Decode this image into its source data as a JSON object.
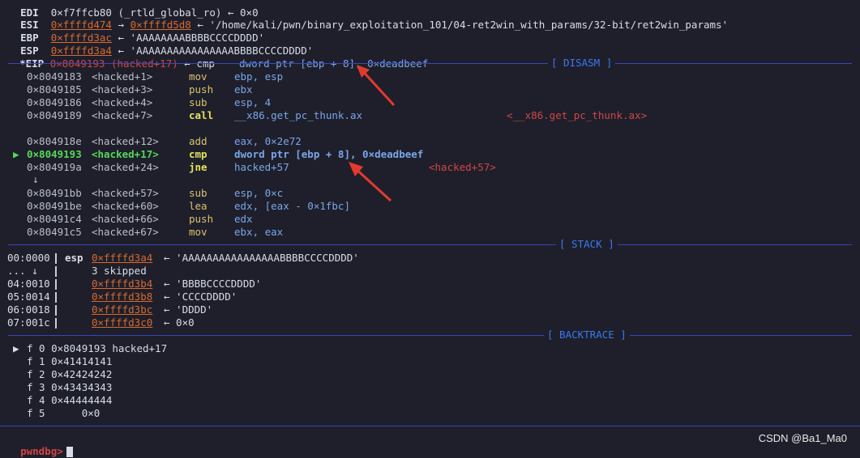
{
  "registers": [
    {
      "name": "EDI",
      "addr": "0×f7ffcb80",
      "rest": "(_rtld_global_ro) ← 0×0",
      "partial": true
    },
    {
      "name": "ESI",
      "addr": "0×ffffd474",
      "arrow": "→",
      "addr2": "0×ffffd5d8",
      "rest": "← '/home/kali/pwn/binary_exploitation_101/04-ret2win_with_params/32-bit/ret2win_params'"
    },
    {
      "name": "EBP",
      "addr": "0×ffffd3ac",
      "rest": "← 'AAAAAAAABBBBCCCCDDDD'"
    },
    {
      "name": "ESP",
      "addr": "0×ffffd3a4",
      "rest": "← 'AAAAAAAAAAAAAAAABBBBCCCCDDDD'"
    },
    {
      "name": "*EIP",
      "addr": "0×8049193 (hacked+17)",
      "arrow": "← cmp",
      "operand": "dword ptr [ebp + 8], 0×deadbeef"
    }
  ],
  "sections": {
    "disasm": "[ DISASM ]",
    "stack": "[ STACK ]",
    "backtrace": "[ BACKTRACE ]"
  },
  "disasm": [
    {
      "addr": "0×8049183",
      "sym": "<hacked+1>",
      "mn": "mov",
      "op": "ebp, esp",
      "extra": ""
    },
    {
      "addr": "0×8049185",
      "sym": "<hacked+3>",
      "mn": "push",
      "op": "ebx",
      "extra": ""
    },
    {
      "addr": "0×8049186",
      "sym": "<hacked+4>",
      "mn": "sub",
      "op": "esp, 4",
      "extra": ""
    },
    {
      "addr": "0×8049189",
      "sym": "<hacked+7>",
      "mn": "call",
      "op": "__x86.get_pc_thunk.ax",
      "extra": "<__x86.get_pc_thunk.ax>"
    },
    {
      "addr": "0×804918e",
      "sym": "<hacked+12>",
      "mn": "add",
      "op": "eax, 0×2e72",
      "extra": ""
    },
    {
      "addr": "0×8049193",
      "sym": "<hacked+17>",
      "mn": "cmp",
      "op": "dword ptr [ebp + 8], 0×deadbeef",
      "extra": "",
      "current": true
    },
    {
      "addr": "0×804919a",
      "sym": "<hacked+24>",
      "mn": "jne",
      "op": "hacked+57",
      "extra": "<hacked+57>"
    },
    {
      "addr": "0×80491bb",
      "sym": "<hacked+57>",
      "mn": "sub",
      "op": "esp, 0×c",
      "extra": ""
    },
    {
      "addr": "0×80491be",
      "sym": "<hacked+60>",
      "mn": "lea",
      "op": "edx, [eax - 0×1fbc]",
      "extra": ""
    },
    {
      "addr": "0×80491c4",
      "sym": "<hacked+66>",
      "mn": "push",
      "op": "edx",
      "extra": ""
    },
    {
      "addr": "0×80491c5",
      "sym": "<hacked+67>",
      "mn": "mov",
      "op": "ebx, eax",
      "extra": ""
    }
  ],
  "disasm_marker": "▶",
  "down_arrow": "↓",
  "stack": [
    {
      "idx": "00:0000",
      "reg": "esp",
      "addr": "0×ffffd3a4",
      "val": "← 'AAAAAAAAAAAAAAAABBBBCCCCDDDD'"
    },
    {
      "idx": "... ↓",
      "reg": "",
      "addr": "",
      "val": "3 skipped"
    },
    {
      "idx": "04:0010",
      "reg": "",
      "addr": "0×ffffd3b4",
      "val": "← 'BBBBCCCCDDDD'"
    },
    {
      "idx": "05:0014",
      "reg": "",
      "addr": "0×ffffd3b8",
      "val": "← 'CCCCDDDD'"
    },
    {
      "idx": "06:0018",
      "reg": "",
      "addr": "0×ffffd3bc",
      "val": "← 'DDDD'"
    },
    {
      "idx": "07:001c",
      "reg": "",
      "addr": "0×ffffd3c0",
      "val": "← 0×0"
    }
  ],
  "backtrace": [
    {
      "text": "f 0 0×8049193 hacked+17",
      "current": true
    },
    {
      "text": "f 1 0×41414141"
    },
    {
      "text": "f 2 0×42424242"
    },
    {
      "text": "f 3 0×43434343"
    },
    {
      "text": "f 4 0×44444444"
    },
    {
      "text": "f 5      0×0"
    }
  ],
  "prompt": "pwndbg>",
  "watermark": "CSDN @Ba1_Ma0",
  "colors": {
    "background": "#1e1f2b",
    "address": "#d86a2e",
    "section_line": "#3b46b8",
    "current_line": "#55d855",
    "annotation_arrow": "#e23a2e"
  }
}
